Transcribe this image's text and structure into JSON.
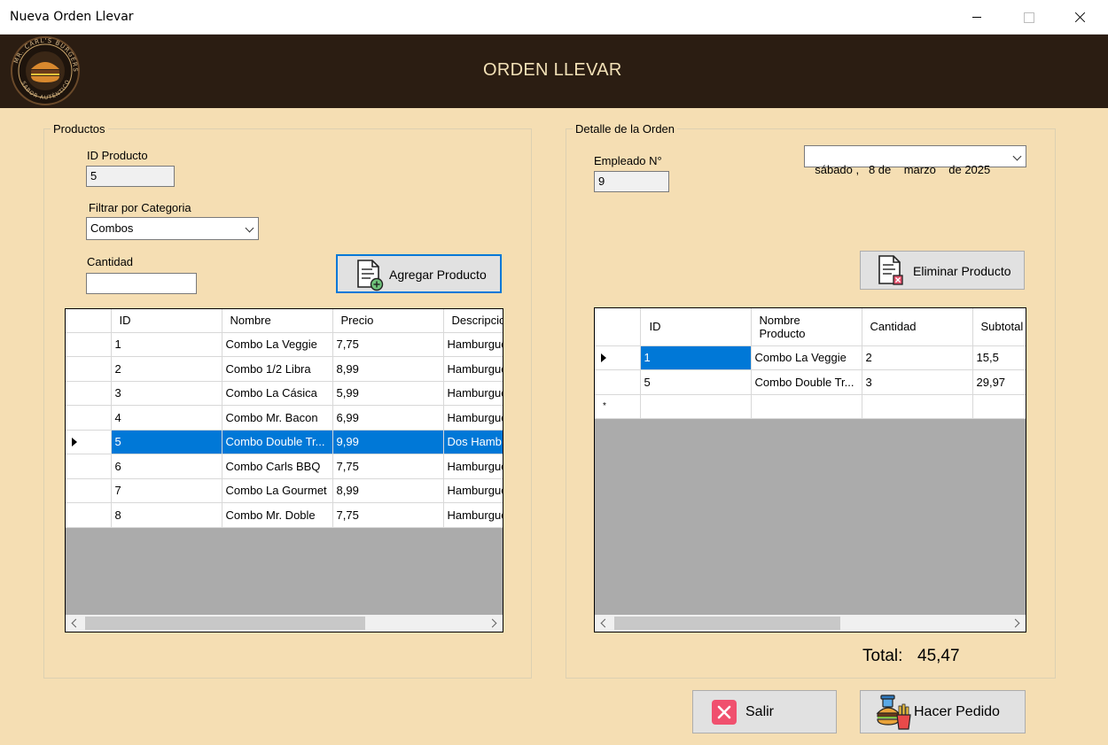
{
  "window": {
    "title": "Nueva Orden Llevar"
  },
  "header": {
    "title": "ORDEN LLEVAR",
    "logo_text": "MR. CARL'S BURGERS · SABOR AUTÉNTICO"
  },
  "productos": {
    "group_label": "Productos",
    "id_label": "ID Producto",
    "id_value": "5",
    "filter_label": "Filtrar por Categoria",
    "filter_value": "Combos",
    "cantidad_label": "Cantidad",
    "cantidad_value": "",
    "add_button": "Agregar Producto",
    "grid": {
      "columns": [
        "ID",
        "Nombre",
        "Precio",
        "Descripcio"
      ],
      "rows": [
        [
          "1",
          "Combo La Veggie",
          "7,75",
          "Hamburgue"
        ],
        [
          "2",
          "Combo 1/2 Libra",
          "8,99",
          "Hamburgue"
        ],
        [
          "3",
          "Combo La Cásica",
          "5,99",
          "Hamburgue"
        ],
        [
          "4",
          "Combo Mr. Bacon",
          "6,99",
          "Hamburgue"
        ],
        [
          "5",
          "Combo Double Tr...",
          "9,99",
          "Dos Hamb"
        ],
        [
          "6",
          "Combo Carls BBQ",
          "7,75",
          "Hamburgue"
        ],
        [
          "7",
          "Combo La Gourmet",
          "8,99",
          "Hamburgue"
        ],
        [
          "8",
          "Combo Mr. Doble",
          "7,75",
          "Hamburgue"
        ]
      ],
      "selected_row": 4,
      "scroll_position": 0
    }
  },
  "detalle": {
    "group_label": "Detalle de la Orden",
    "empleado_label": "Empleado N°",
    "empleado_value": "9",
    "date_value": "sábado ,   8 de    marzo    de 2025",
    "delete_button": "Eliminar Producto",
    "grid": {
      "columns": [
        "ID",
        "Nombre\nProducto",
        "Cantidad",
        "Subtotal"
      ],
      "rows": [
        [
          "1",
          "Combo La Veggie",
          "2",
          "15,5"
        ],
        [
          "5",
          "Combo Double Tr...",
          "3",
          "29,97"
        ]
      ],
      "current_row": 0,
      "new_row_marker": "*"
    },
    "total_label": "Total:",
    "total_value": "45,47"
  },
  "actions": {
    "salir": "Salir",
    "hacer_pedido": "Hacer Pedido"
  },
  "colors": {
    "background": "#f5deb3",
    "header": "#2b1d12",
    "header_text": "#f3e1b7",
    "selection": "#0078d7"
  }
}
